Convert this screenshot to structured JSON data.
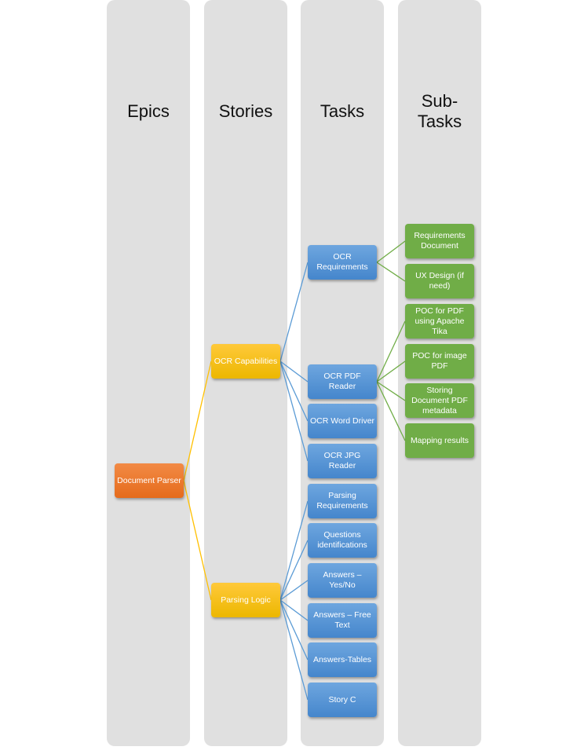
{
  "columns": [
    "Epics",
    "Stories",
    "Tasks",
    "Sub-Tasks"
  ],
  "colors": {
    "epic": "#ed7d31",
    "story": "#ffc000",
    "task": "#5b9bd5",
    "subtask": "#70ad47",
    "column": "#e0e0e0"
  },
  "nodes": {
    "epic": {
      "label": "Document Parser"
    },
    "stories": [
      {
        "label": "OCR Capabilities"
      },
      {
        "label": "Parsing Logic"
      }
    ],
    "tasks": [
      {
        "label": "OCR Requirements",
        "parent": 0
      },
      {
        "label": "OCR PDF Reader",
        "parent": 0
      },
      {
        "label": "OCR Word Driver",
        "parent": 0
      },
      {
        "label": "OCR JPG Reader",
        "parent": 0
      },
      {
        "label": "Parsing Requirements",
        "parent": 1
      },
      {
        "label": "Questions identifications",
        "parent": 1
      },
      {
        "label": "Answers – Yes/No",
        "parent": 1
      },
      {
        "label": "Answers – Free Text",
        "parent": 1
      },
      {
        "label": "Answers-Tables",
        "parent": 1
      },
      {
        "label": "Story C",
        "parent": 1
      }
    ],
    "subtasks": [
      {
        "label": "Requirements Document",
        "parent": 0
      },
      {
        "label": "UX Design (if need)",
        "parent": 0
      },
      {
        "label": "POC for PDF using Apache Tika",
        "parent": 1
      },
      {
        "label": "POC for image PDF",
        "parent": 1
      },
      {
        "label": "Storing Document PDF metadata",
        "parent": 1
      },
      {
        "label": "Mapping results",
        "parent": 1
      }
    ]
  }
}
